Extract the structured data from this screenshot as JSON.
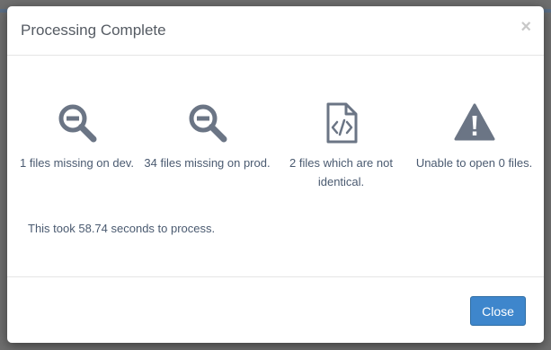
{
  "modal": {
    "title": "Processing Complete",
    "close_glyph": "×"
  },
  "stats": [
    {
      "icon": "zoom-out-icon",
      "label": "1 files missing on dev."
    },
    {
      "icon": "zoom-out-icon",
      "label": "34 files missing on prod."
    },
    {
      "icon": "file-code-icon",
      "label": "2 files which are not identical."
    },
    {
      "icon": "warning-icon",
      "label": "Unable to open 0 files."
    }
  ],
  "summary": "This took 58.74 seconds to process.",
  "footer": {
    "close_label": "Close"
  },
  "colors": {
    "icon": "#6b7585",
    "text": "#4a5a70",
    "primary_button": "#3e86cc"
  }
}
